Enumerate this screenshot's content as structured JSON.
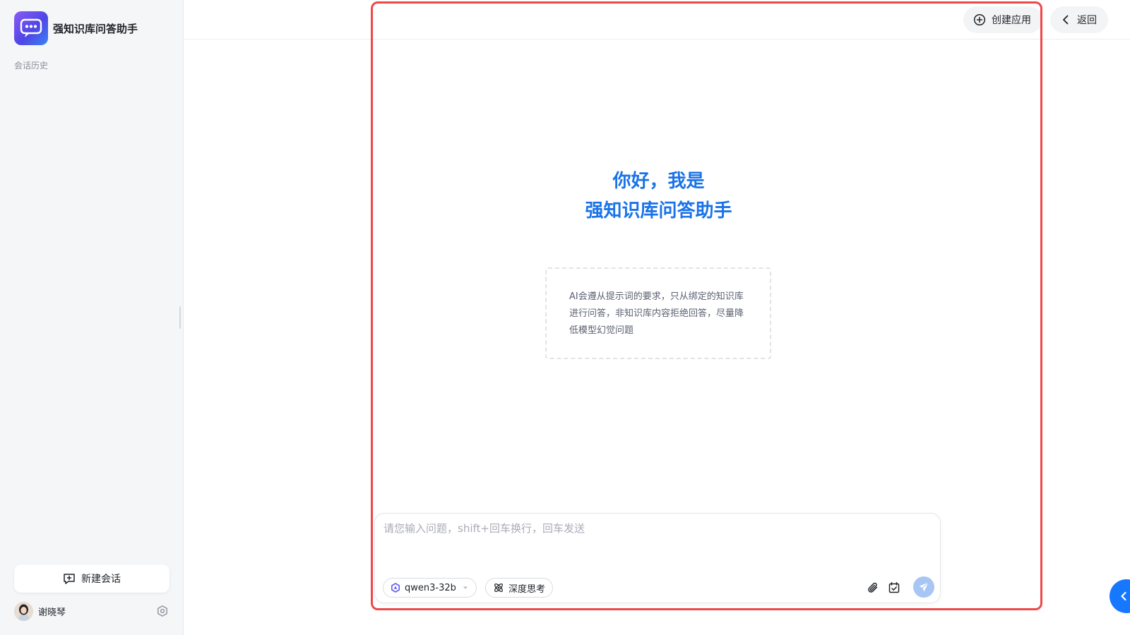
{
  "app": {
    "title": "强知识库问答助手"
  },
  "sidebar": {
    "history_label": "会话历史",
    "new_chat_label": "新建会话",
    "user": {
      "name": "谢晓琴"
    }
  },
  "topbar": {
    "create_app_label": "创建应用",
    "back_label": "返回"
  },
  "greeting": {
    "line1": "你好，我是",
    "line2": "强知识库问答助手"
  },
  "description": "AI会遵从提示词的要求，只从绑定的知识库进行问答，非知识库内容拒绝回答，尽量降低模型幻觉问题",
  "composer": {
    "placeholder": "请您输入问题，shift+回车换行，回车发送",
    "value": "",
    "model_label": "qwen3-32b",
    "deep_think_label": "深度思考"
  },
  "colors": {
    "accent": "#1a73e8",
    "highlight_frame": "#f04747",
    "send_button_disabled": "#a7c6f4",
    "float_button": "#1677ff"
  }
}
